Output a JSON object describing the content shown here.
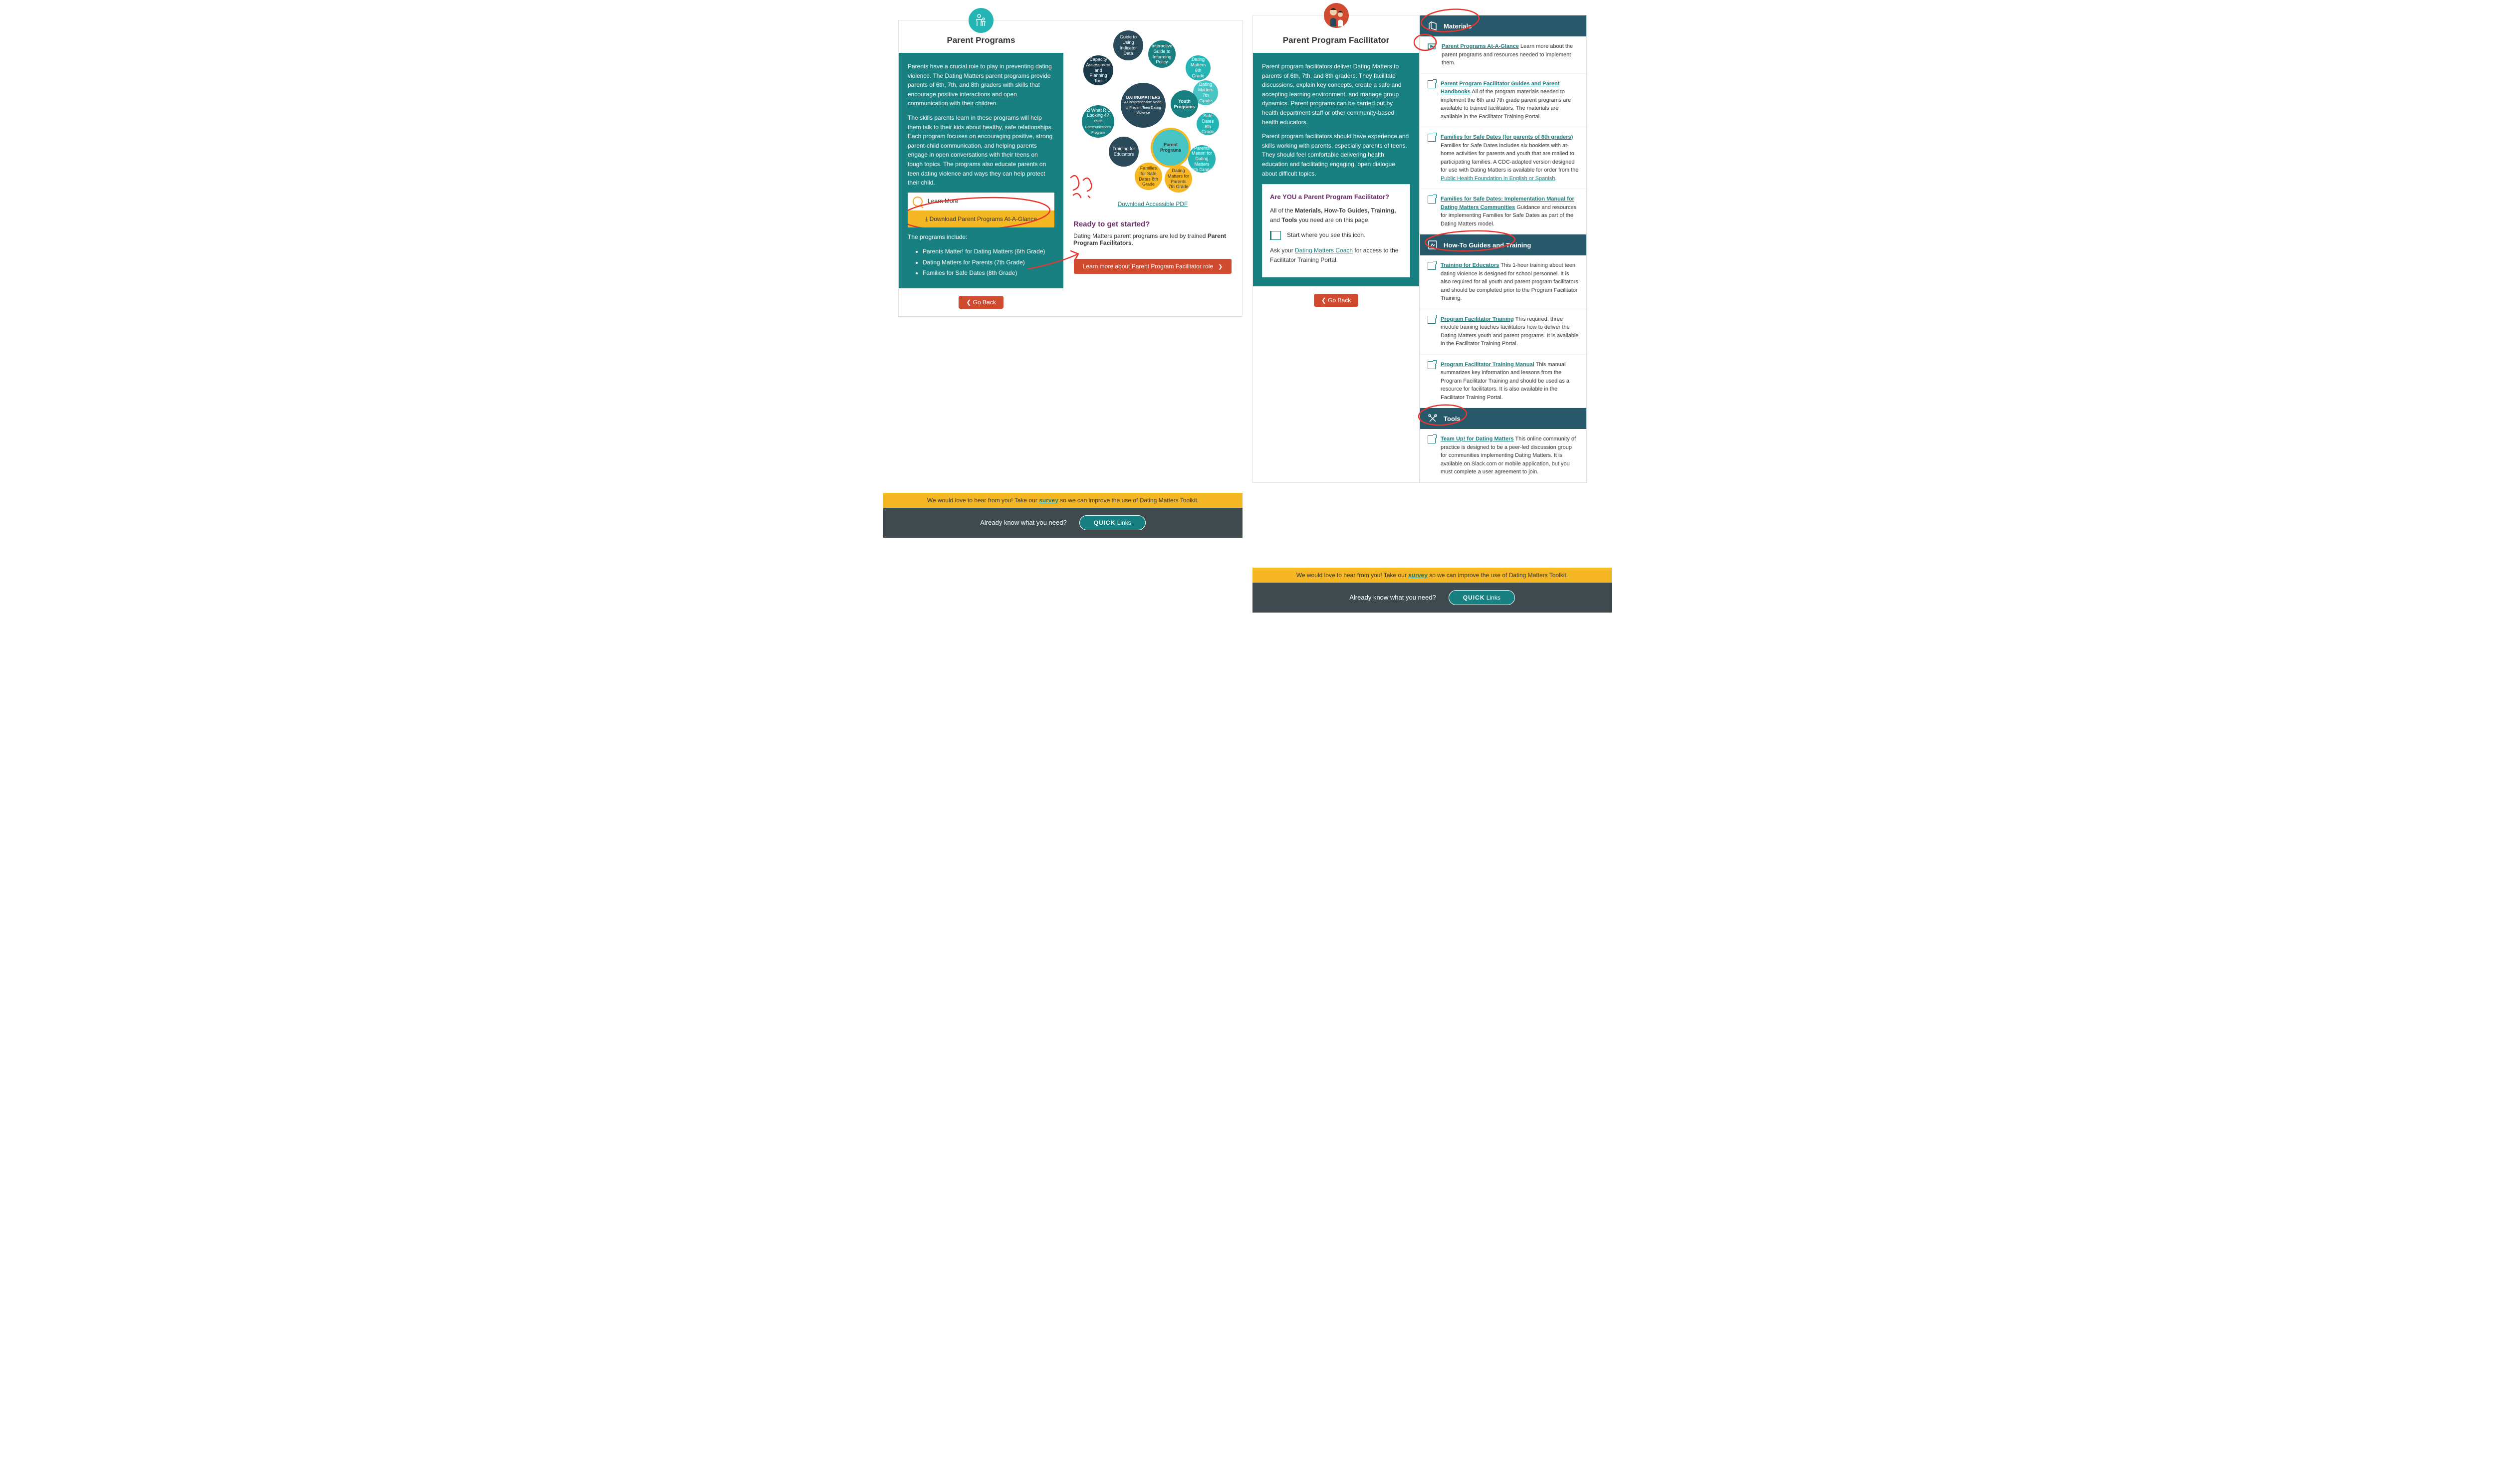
{
  "screen1": {
    "header": "Parent Programs",
    "p1": "Parents have a crucial role to play in preventing dating violence. The Dating Matters parent programs provide parents of 6th, 7th, and 8th graders with skills that encourage positive interactions and open communication with their children.",
    "p2": "The skills parents learn in these programs will help them talk to their kids about healthy, safe relationships. Each program focuses on encouraging positive, strong parent-child communication, and helping parents engage in open conversations with their teens on tough topics. The programs also educate parents on teen dating violence and ways they can help protect their child.",
    "learn_more": "Learn More",
    "download": "⤓ Download Parent Programs At-A-Glance",
    "programs_include": "The programs include:",
    "bullets": [
      "Parents Matter! for Dating Matters (6th Grade)",
      "Dating Matters for Parents (7th Grade)",
      "Families for Safe Dates (8th Grade)"
    ],
    "go_back": "❮ Go Back",
    "diagram": {
      "center1": "DATING",
      "center2": "MATTERS",
      "center_sub": "A Comprehensive Model to Prevent Teen Dating Violence",
      "b1": "Guide to Using Indicator Data",
      "b2": "Interactive Guide to Informing Policy",
      "b3": "Capacity Assessment and Planning Tool",
      "b4": "Dating Matters 6th Grade",
      "b5": "Youth Programs",
      "b6": "Dating Matters 7th Grade",
      "b7": "Safe Dates 8th Grade",
      "b8": "i2i What R U Looking 4?",
      "b8s": "Youth Communications Program",
      "b9": "Training for Educators",
      "b10": "Parent Programs",
      "b11": "Parents Matter! for Dating Matters 6th Grade",
      "b12": "Families for Safe Dates 8th Grade",
      "b13": "Dating Matters for Parents 7th Grade"
    },
    "pdf_link": "Download Accessible PDF",
    "ready_h": "Ready to get started?",
    "ready_p1": "Dating Matters parent programs are led by trained ",
    "ready_b": "Parent Program Facilitators",
    "big_btn": "Learn more about Parent Program Facilitator role"
  },
  "screen2": {
    "header": "Parent Program Facilitator",
    "p1": "Parent program facilitators deliver Dating Matters to parents of 6th, 7th, and 8th graders. They facilitate discussions, explain key concepts, create a safe and accepting learning environment, and manage group dynamics. Parent programs can be carried out by health department staff or other community-based health educators.",
    "p2": "Parent program facilitators should have experience and skills working with parents, especially parents of teens. They should feel comfortable delivering health education and facilitating engaging, open dialogue about difficult topics.",
    "ay_h": "Are YOU a Parent Program Facilitator?",
    "ay_p1a": "All of the ",
    "ay_p1b": "Materials, How-To Guides, Training,",
    "ay_p1c": " and ",
    "ay_p1d": "Tools",
    "ay_p1e": " you need are on this page.",
    "ay_flag": "Start where you see this icon.",
    "ay_ask1": "Ask your ",
    "ay_ask_link": "Dating Matters Coach",
    "ay_ask2": " for access to the Facilitator Training Portal.",
    "go_back": "❮ Go Back",
    "sec_materials": "Materials",
    "sec_howto": "How-To Guides and Training",
    "sec_tools": "Tools",
    "m1_link": "Parent Programs At-A-Glance",
    "m1_txt": " Learn more about the parent programs and resources needed to implement them.",
    "m2_link": "Parent Program Facilitator Guides and Parent Handbooks",
    "m2_txt": " All of the program materials needed to implement the 6th and 7th grade parent programs are available to trained facilitators. The materials are available in the Facilitator Training Portal.",
    "m3_link": "Families for Safe Dates (for parents of 8th graders)",
    "m3_txt": " Families for Safe Dates includes six booklets with at-home activities for parents and youth that are mailed to participating families. A CDC-adapted version designed for use with Dating Matters is available for order from the ",
    "m3_link2": "Public Health Foundation in English or Spanish",
    "m4_link": "Families for Safe Dates: Implementation Manual for Dating Matters Communities",
    "m4_txt": " Guidance and resources for implementing Families for Safe Dates as part of the Dating Matters model.",
    "h1_link": "Training for Educators",
    "h1_txt": " This 1-hour training about teen dating violence is designed for school personnel. It is also required for all youth and parent program facilitators and should be completed prior to the Program Facilitator Training.",
    "h2_link": "Program Facilitator Training",
    "h2_txt": "  This required, three module training teaches facilitators how to deliver the Dating Matters youth and parent programs. It is available in the Facilitator Training Portal.",
    "h3_link": "Program Facilitator Training Manual",
    "h3_txt": " This manual summarizes key information and lessons from the Program Facilitator Training and should be used as a resource for facilitators. It is also available in the Facilitator Training Portal.",
    "t1_link": "Team Up! for Dating Matters",
    "t1_txt": " This online community of practice is designed to be a peer-led discussion group for communities implementing Dating Matters. It is available on Slack.com or mobile application, but you must complete a user agreement to join."
  },
  "footer": {
    "survey1": "We would love to hear from you! Take our ",
    "survey_link": "survey",
    "survey2": " so we can improve the use of Dating Matters Toolkit.",
    "quick_label": "Already know what you need?",
    "quick_b": "QUICK",
    "quick_t": " Links"
  }
}
